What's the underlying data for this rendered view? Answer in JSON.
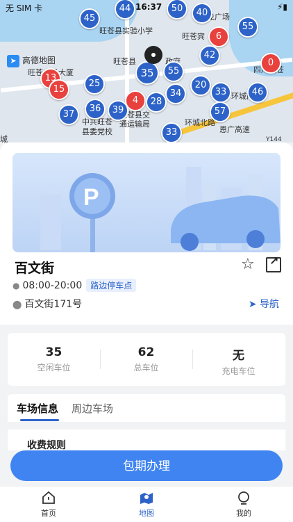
{
  "status_bar": {
    "carrier": "无 SIM 卡",
    "time": "16:37"
  },
  "map": {
    "labels": [
      "高德地图",
      "旺苍县实验小学",
      "龙广场",
      "旺苍宾",
      "旺苍县",
      "政府",
      "旺苍广场大厦",
      "四川旺苍",
      "中共旺苍",
      "县委党校",
      "旺苍县交",
      "通运输局",
      "环城北路",
      "环城南",
      "恩广高速",
      "Y144",
      "城"
    ],
    "pins": [
      {
        "label": "44",
        "color": "blue"
      },
      {
        "label": "50",
        "color": "blue"
      },
      {
        "label": "45",
        "color": "blue"
      },
      {
        "label": "40",
        "color": "blue"
      },
      {
        "label": "55",
        "color": "blue"
      },
      {
        "label": "6",
        "color": "red"
      },
      {
        "label": "42",
        "color": "blue"
      },
      {
        "label": "0",
        "color": "red"
      },
      {
        "label": "35",
        "color": "blue"
      },
      {
        "label": "55",
        "color": "blue"
      },
      {
        "label": "13",
        "color": "red"
      },
      {
        "label": "15",
        "color": "red"
      },
      {
        "label": "25",
        "color": "blue"
      },
      {
        "label": "20",
        "color": "blue"
      },
      {
        "label": "33",
        "color": "blue"
      },
      {
        "label": "46",
        "color": "blue"
      },
      {
        "label": "4",
        "color": "red"
      },
      {
        "label": "34",
        "color": "blue"
      },
      {
        "label": "37",
        "color": "blue"
      },
      {
        "label": "36",
        "color": "blue"
      },
      {
        "label": "39",
        "color": "blue"
      },
      {
        "label": "28",
        "color": "blue"
      },
      {
        "label": "57",
        "color": "blue"
      },
      {
        "label": "33",
        "color": "blue"
      }
    ]
  },
  "parking": {
    "name": "百文街",
    "hours": "08:00-20:00",
    "type_tag": "路边停车点",
    "address": "百文街171号",
    "navigate_label": "导航"
  },
  "stats": [
    {
      "value": "35",
      "label": "空闲车位"
    },
    {
      "value": "62",
      "label": "总车位"
    },
    {
      "value": "无",
      "label": "充电车位"
    }
  ],
  "tabs": [
    "车场信息",
    "周边车场"
  ],
  "section_title": "收费规则",
  "primary_button": "包期办理",
  "tabbar": [
    {
      "label": "首页"
    },
    {
      "label": "地图"
    },
    {
      "label": "我的"
    }
  ],
  "colors": {
    "accent": "#3f84f0",
    "pin_blue": "#2d63c9",
    "pin_red": "#e8413e"
  }
}
